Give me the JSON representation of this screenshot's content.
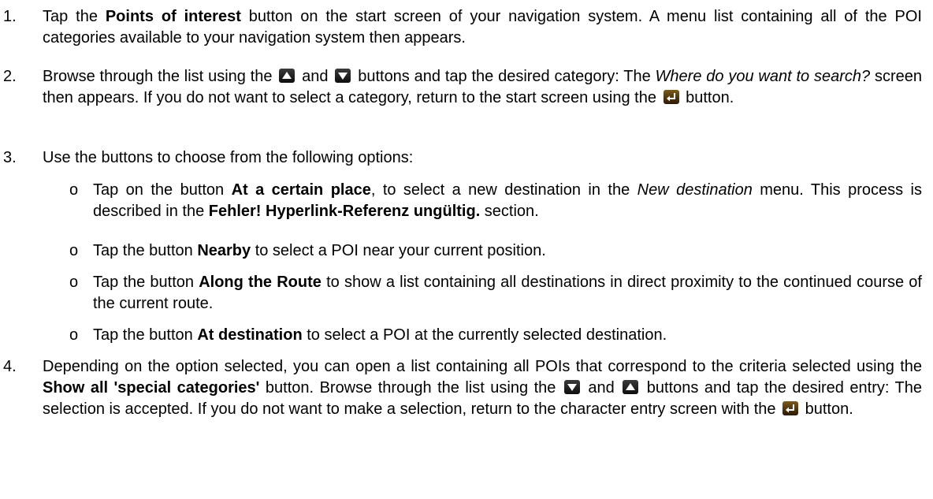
{
  "steps": [
    {
      "num": "1.",
      "p1": "Tap the ",
      "b1": "Points of interest",
      "p2": " button on the start screen of your navigation system. A menu list containing all of the POI categories available to your navigation system then appears."
    },
    {
      "num": "2.",
      "p1": "Browse through the list using the",
      "p2": "and",
      "p3": "buttons and tap the desired category: The ",
      "i1": "Where do you want to search?",
      "p4": " screen then appears. If you do not want to select a category, return to the start screen using the",
      "p5": "button."
    },
    {
      "num": "3.",
      "p1": "Use the buttons to choose from the following options:"
    },
    {
      "num": "4.",
      "p1": "Depending on the option selected, you can open a list containing all POIs that correspond to the criteria selected using the ",
      "b1": "Show all 'special categories'",
      "p2": " button. Browse through the list using the",
      "p3": "and",
      "p4": "buttons and tap the desired entry: The selection is accepted. If you do not want to make a selection, return to the character entry screen with the",
      "p5": "button."
    }
  ],
  "options": [
    {
      "bullet": "o",
      "p1": "Tap on the button ",
      "b1": "At a certain place",
      "p2": ", to select a new destination in the ",
      "i1": "New destination",
      "p3": " menu. This process is described in the ",
      "b2": "Fehler! Hyperlink-Referenz ungültig.",
      "p4": " section."
    },
    {
      "bullet": "o",
      "p1": "Tap the button ",
      "b1": "Nearby",
      "p2": " to select a POI near your current position."
    },
    {
      "bullet": "o",
      "p1": "Tap the button ",
      "b1": "Along the Route",
      "p2": " to show a list containing all destinations in direct proximity to the continued course of the current route."
    },
    {
      "bullet": "o",
      "p1": "Tap the button ",
      "b1": "At destination",
      "p2": " to select a POI at the currently selected destination."
    }
  ],
  "icons": {
    "up": "arrow-up-icon",
    "down": "arrow-down-icon",
    "back": "return-icon"
  }
}
